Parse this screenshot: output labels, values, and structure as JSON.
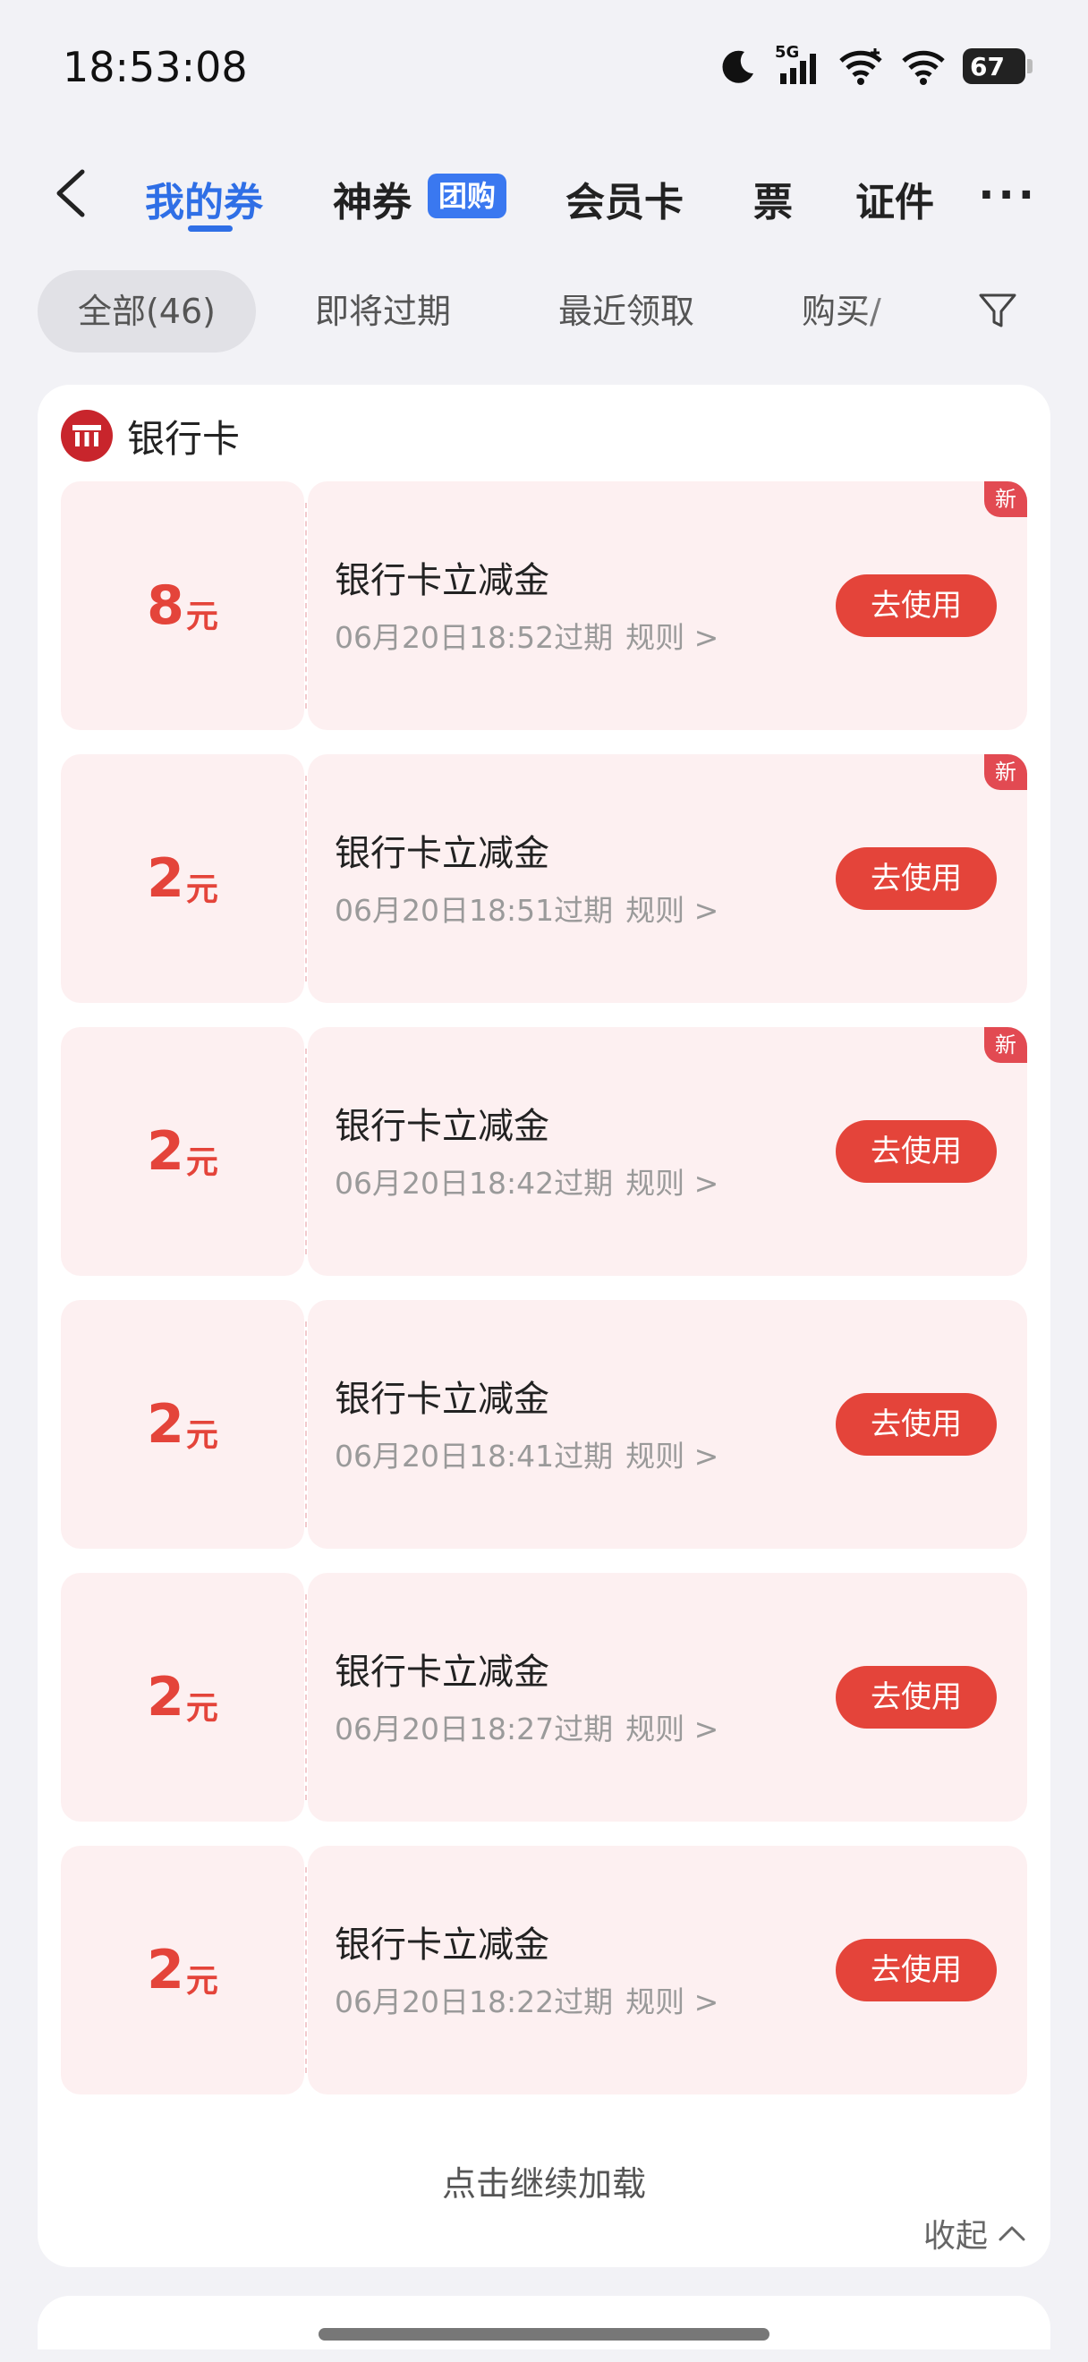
{
  "status_bar": {
    "time": "18:53:08",
    "network": "5G",
    "battery": "67"
  },
  "nav": {
    "tabs": [
      {
        "label": "我的券",
        "active": true
      },
      {
        "label": "神券",
        "badge": "团购"
      },
      {
        "label": "会员卡"
      },
      {
        "label": "票"
      },
      {
        "label": "证件"
      }
    ],
    "more": "···"
  },
  "filters": {
    "chips": [
      "全部(46)",
      "即将过期",
      "最近领取",
      "购买/"
    ],
    "selected": "全部(46)"
  },
  "section": {
    "title": "银行卡",
    "coupons": [
      {
        "amount": "8",
        "unit": "元",
        "title": "银行卡立减金",
        "expiry": "06月20日18:52过期",
        "rule": "规则 >",
        "button": "去使用",
        "tag": "新"
      },
      {
        "amount": "2",
        "unit": "元",
        "title": "银行卡立减金",
        "expiry": "06月20日18:51过期",
        "rule": "规则 >",
        "button": "去使用",
        "tag": "新"
      },
      {
        "amount": "2",
        "unit": "元",
        "title": "银行卡立减金",
        "expiry": "06月20日18:42过期",
        "rule": "规则 >",
        "button": "去使用",
        "tag": "新"
      },
      {
        "amount": "2",
        "unit": "元",
        "title": "银行卡立减金",
        "expiry": "06月20日18:41过期",
        "rule": "规则 >",
        "button": "去使用",
        "tag": ""
      },
      {
        "amount": "2",
        "unit": "元",
        "title": "银行卡立减金",
        "expiry": "06月20日18:27过期",
        "rule": "规则 >",
        "button": "去使用",
        "tag": ""
      },
      {
        "amount": "2",
        "unit": "元",
        "title": "银行卡立减金",
        "expiry": "06月20日18:22过期",
        "rule": "规则 >",
        "button": "去使用",
        "tag": ""
      }
    ],
    "load_more": "点击继续加载",
    "collapse": "收起"
  },
  "colors": {
    "accent_blue": "#2f6fe6",
    "coupon_red": "#e4443a",
    "coupon_bg": "#fdf0f1"
  }
}
